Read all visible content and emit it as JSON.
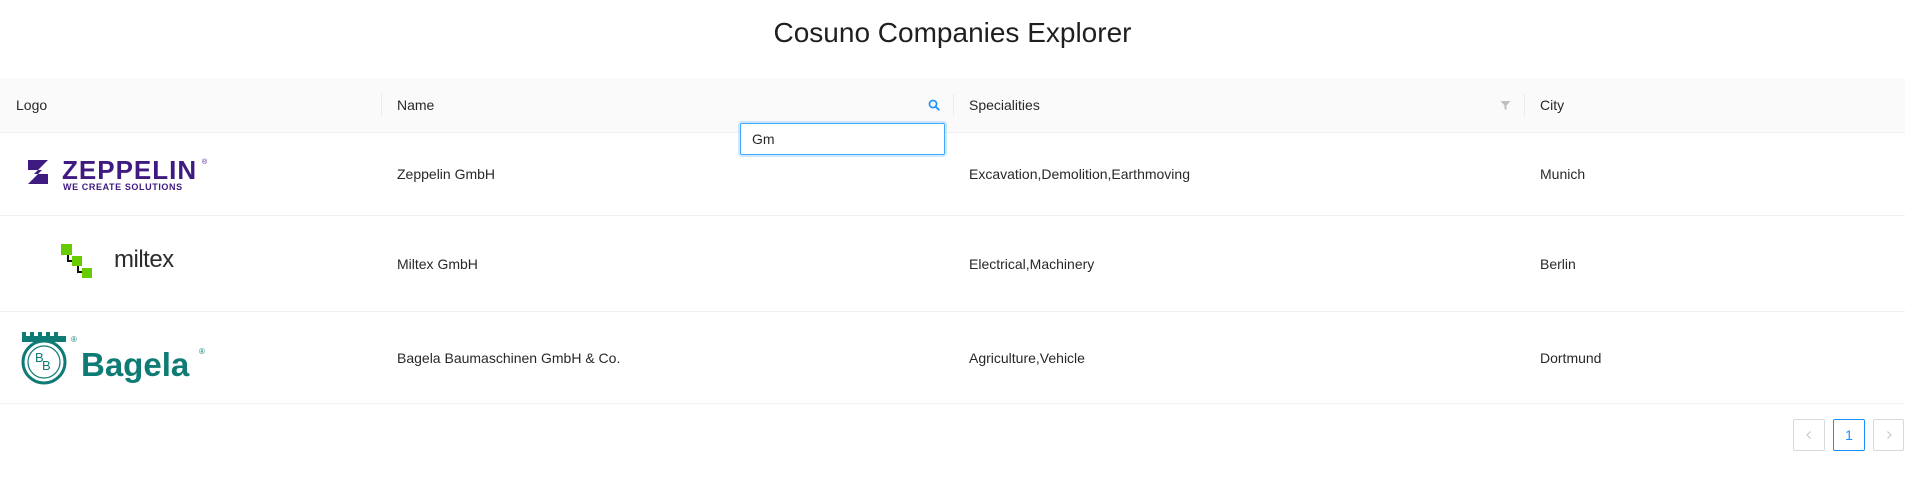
{
  "page": {
    "title": "Cosuno Companies Explorer"
  },
  "table": {
    "columns": [
      {
        "key": "logo",
        "label": "Logo"
      },
      {
        "key": "name",
        "label": "Name"
      },
      {
        "key": "specialities",
        "label": "Specialities"
      },
      {
        "key": "city",
        "label": "City"
      }
    ],
    "rows": [
      {
        "logo": {
          "brand": "zeppelin-logo",
          "text": "ZEPPELIN",
          "tagline": "WE CREATE SOLUTIONS",
          "color": "#3f1a80"
        },
        "name": "Zeppelin GmbH",
        "specialities": "Excavation,Demolition,Earthmoving",
        "city": "Munich"
      },
      {
        "logo": {
          "brand": "miltex-logo",
          "text": "miltex",
          "color": "#66cc00"
        },
        "name": "Miltex GmbH",
        "specialities": "Electrical,Machinery",
        "city": "Berlin"
      },
      {
        "logo": {
          "brand": "bagela-logo",
          "text": "Bagela",
          "color": "#0f7b75"
        },
        "name": "Bagela Baumaschinen GmbH & Co.",
        "specialities": "Agriculture,Vehicle",
        "city": "Dortmund"
      }
    ]
  },
  "name_filter": {
    "value": "Gm",
    "icon": "search-icon"
  },
  "specialities_filter": {
    "icon": "filter-icon"
  },
  "pagination": {
    "prev_icon": "chevron-left-icon",
    "current_page": "1",
    "next_icon": "chevron-right-icon"
  },
  "colors": {
    "accent": "#1890ff",
    "header_bg": "#fafafa",
    "border": "#f0f0f0"
  }
}
